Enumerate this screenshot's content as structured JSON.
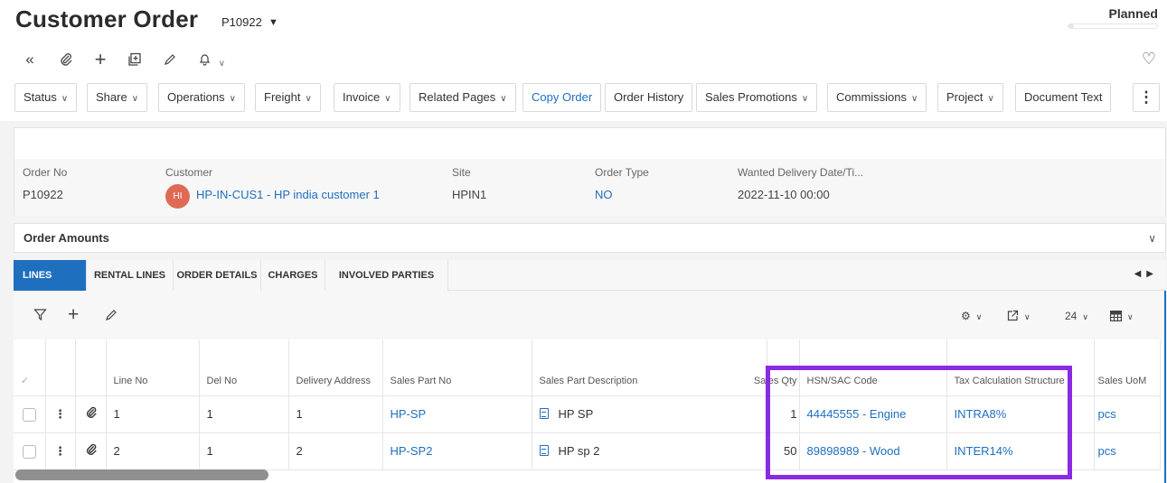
{
  "header": {
    "title": "Customer Order",
    "order_id": "P10922",
    "status": "Planned",
    "status_progress": 0.06
  },
  "toolbar_icons": [
    "double-chevron-left-icon",
    "paperclip-icon",
    "plus-icon",
    "duplicate-icon",
    "pencil-icon",
    "bell-icon",
    "heart-icon"
  ],
  "buttons": {
    "status": "Status",
    "share": "Share",
    "operations": "Operations",
    "freight": "Freight",
    "invoice": "Invoice",
    "related_pages": "Related Pages",
    "copy_order": "Copy Order",
    "order_history": "Order History",
    "sales_promotions": "Sales Promotions",
    "commissions": "Commissions",
    "project": "Project",
    "document_text": "Document Text",
    "more": "⋮"
  },
  "info": {
    "order_no_label": "Order No",
    "order_no": "P10922",
    "customer_label": "Customer",
    "customer_avatar": "HI",
    "customer": "HP-IN-CUS1 - HP india customer 1",
    "site_label": "Site",
    "site": "HPIN1",
    "order_type_label": "Order Type",
    "order_type": "NO",
    "delivery_label": "Wanted Delivery Date/Ti...",
    "delivery": "2022-11-10 00:00"
  },
  "order_amounts": "Order Amounts",
  "tabs": {
    "lines": "LINES",
    "rental_lines": "RENTAL LINES",
    "order_details": "ORDER DETAILS",
    "charges": "CHARGES",
    "involved_parties": "INVOLVED PARTIES"
  },
  "grid_tools": {
    "page_size": "24"
  },
  "table": {
    "headers": {
      "check": "✓",
      "line_no": "Line No",
      "del_no": "Del No",
      "delivery_address": "Delivery Address",
      "sales_part_no": "Sales Part No",
      "sales_part_desc": "Sales Part Description",
      "sales_qty": "Sales Qty",
      "hsn": "HSN/SAC Code",
      "tax": "Tax Calculation Structure",
      "uom": "Sales UoM"
    },
    "rows": [
      {
        "line_no": "1",
        "del_no": "1",
        "delivery_address": "1",
        "sales_part_no": "HP-SP",
        "sales_part_desc": "HP SP",
        "sales_qty": "1",
        "hsn": "44445555 - Engine",
        "tax": "INTRA8%",
        "uom": "pcs"
      },
      {
        "line_no": "2",
        "del_no": "1",
        "delivery_address": "2",
        "sales_part_no": "HP-SP2",
        "sales_part_desc": "HP sp 2",
        "sales_qty": "50",
        "hsn": "89898989 - Wood",
        "tax": "INTER14%",
        "uom": "pcs"
      }
    ]
  },
  "colors": {
    "accent": "#1f6fbf",
    "highlight": "#8a2be2",
    "avatar": "#e06b55"
  }
}
